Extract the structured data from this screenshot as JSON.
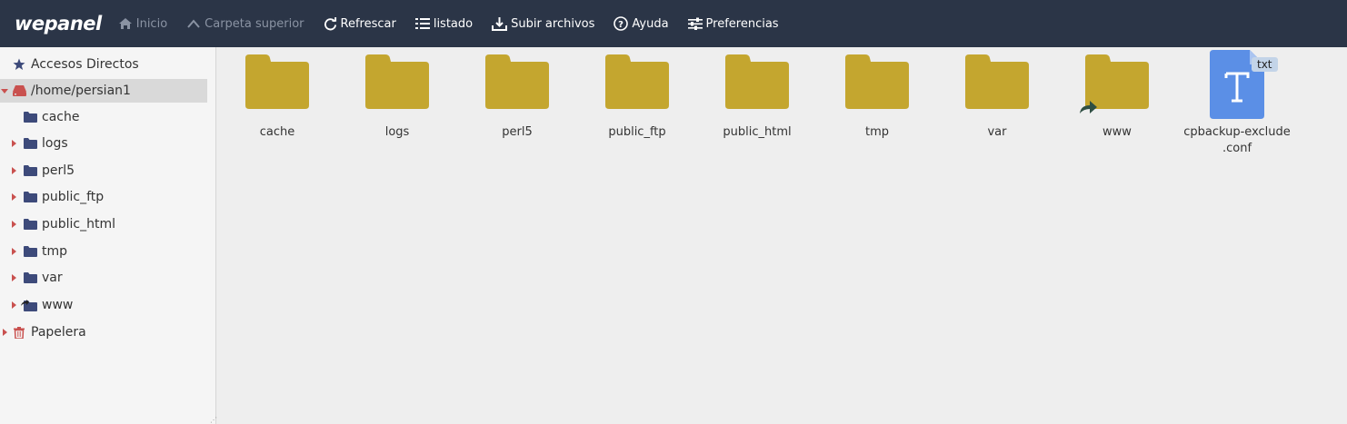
{
  "app": {
    "logo": "wepanel"
  },
  "toolbar": [
    {
      "label": "Inicio",
      "icon": "home-icon",
      "disabled": true
    },
    {
      "label": "Carpeta superior",
      "icon": "chevron-up-icon",
      "disabled": true
    },
    {
      "label": "Refrescar",
      "icon": "refresh-icon",
      "disabled": false
    },
    {
      "label": "listado",
      "icon": "list-icon",
      "disabled": false
    },
    {
      "label": "Subir archivos",
      "icon": "upload-icon",
      "disabled": false
    },
    {
      "label": "Ayuda",
      "icon": "help-icon",
      "disabled": false
    },
    {
      "label": "Preferencias",
      "icon": "sliders-icon",
      "disabled": false
    }
  ],
  "sidebar": {
    "shortcuts": "Accesos Directos",
    "root": "/home/persian1",
    "folders": [
      "cache",
      "logs",
      "perl5",
      "public_ftp",
      "public_html",
      "tmp",
      "var",
      "www"
    ],
    "trash": "Papelera"
  },
  "main": {
    "items": [
      {
        "name": "cache",
        "type": "folder"
      },
      {
        "name": "logs",
        "type": "folder"
      },
      {
        "name": "perl5",
        "type": "folder"
      },
      {
        "name": "public_ftp",
        "type": "folder"
      },
      {
        "name": "public_html",
        "type": "folder"
      },
      {
        "name": "tmp",
        "type": "folder"
      },
      {
        "name": "var",
        "type": "folder"
      },
      {
        "name": "www",
        "type": "folder-link"
      },
      {
        "name_line1": "cpbackup-exclude",
        "name_line2": ".conf",
        "type": "text-file",
        "badge": "txt"
      }
    ]
  },
  "colors": {
    "topbar": "#2b3547",
    "folder": "#c4a62f",
    "sidebar_folder": "#3d4a7a",
    "caret": "#c9514f",
    "file": "#5b8fe6"
  }
}
